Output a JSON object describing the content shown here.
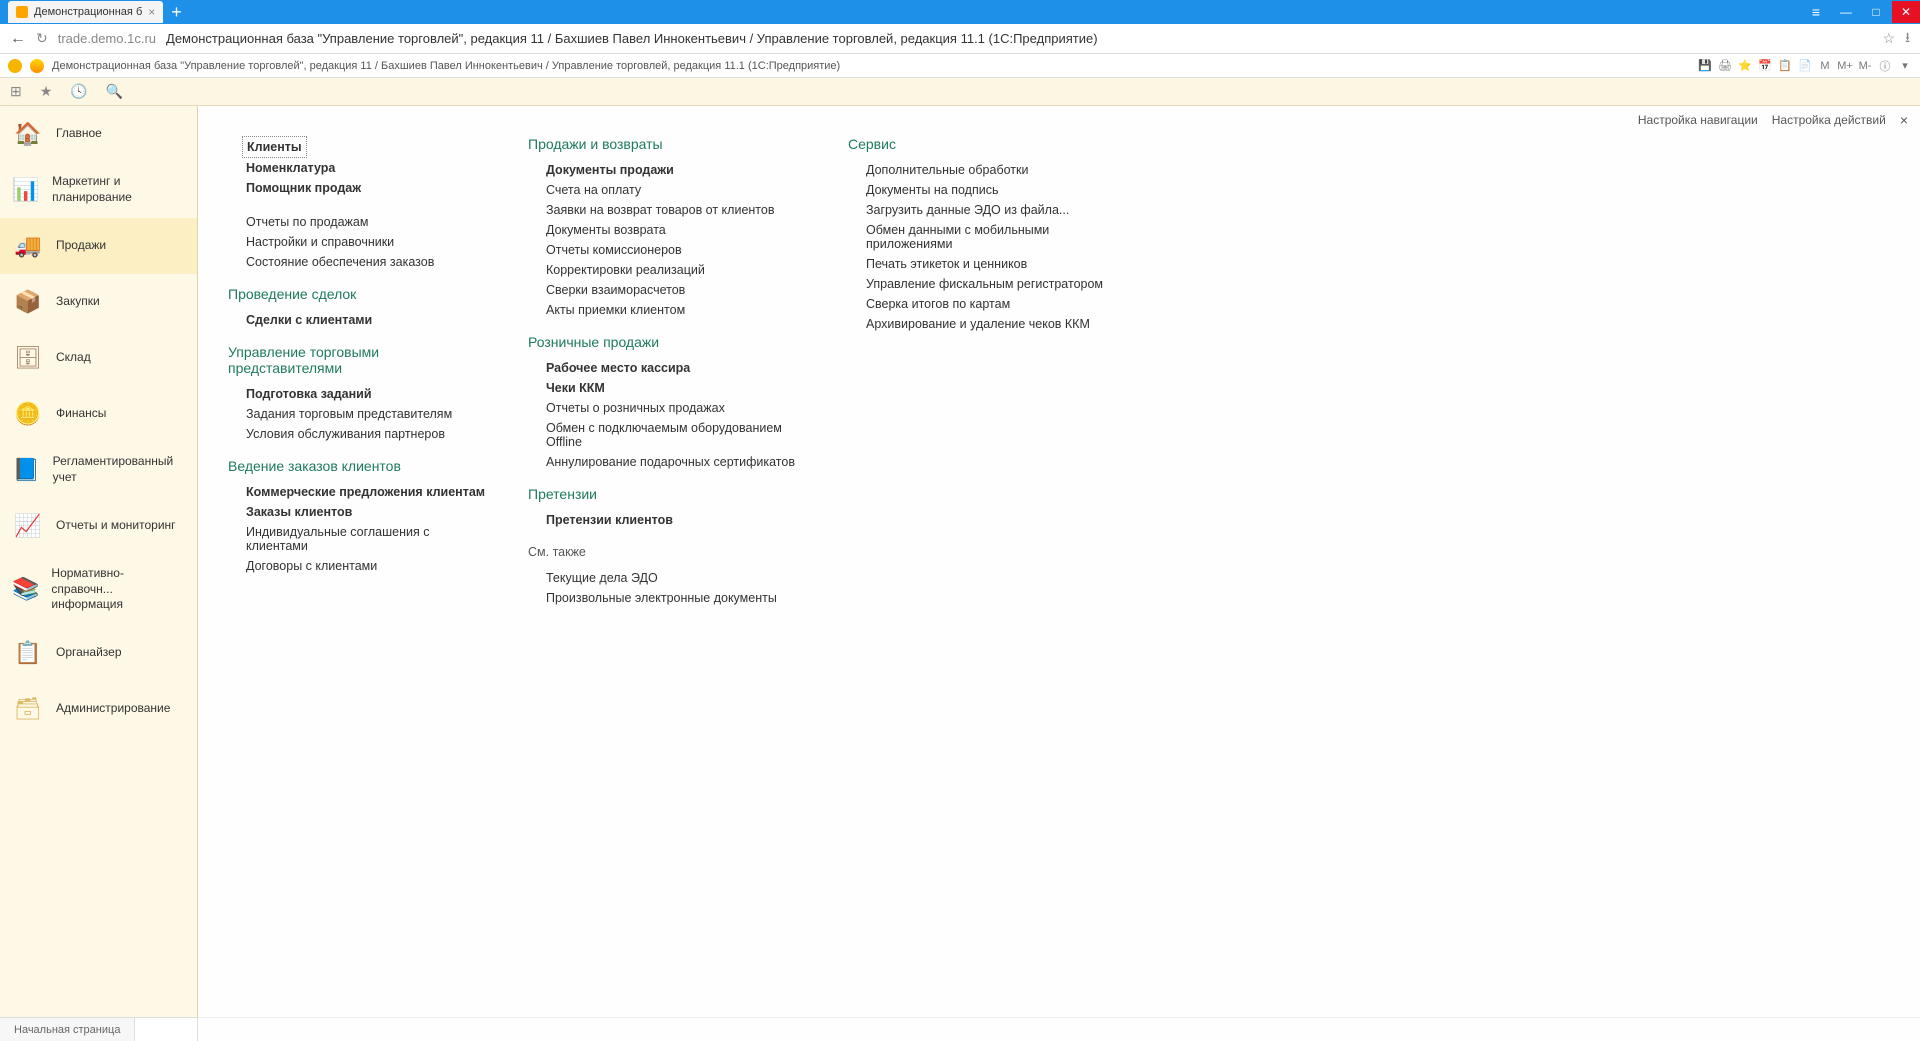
{
  "browser": {
    "tab_title": "Демонстрационная б",
    "url": "trade.demo.1c.ru",
    "page_title": "Демонстрационная база \"Управление торговлей\", редакция 11 / Бахшиев Павел Иннокентьевич / Управление торговлей, редакция 11.1 (1С:Предприятие)"
  },
  "app_header": {
    "title": "Демонстрационная база \"Управление торговлей\", редакция 11 / Бахшиев Павел Иннокентьевич / Управление торговлей, редакция 11.1  (1С:Предприятие)",
    "m": "M",
    "mplus": "M+",
    "mminus": "M-"
  },
  "sidebar": {
    "items": [
      {
        "label": "Главное"
      },
      {
        "label": "Маркетинг и планирование"
      },
      {
        "label": "Продажи"
      },
      {
        "label": "Закупки"
      },
      {
        "label": "Склад"
      },
      {
        "label": "Финансы"
      },
      {
        "label": "Регламентированный учет"
      },
      {
        "label": "Отчеты и мониторинг"
      },
      {
        "label": "Нормативно-справочн... информация"
      },
      {
        "label": "Органайзер"
      },
      {
        "label": "Администрирование"
      }
    ]
  },
  "content_header": {
    "nav_settings": "Настройка навигации",
    "action_settings": "Настройка действий"
  },
  "col1": {
    "group0": [
      {
        "t": "Клиенты",
        "bold": true,
        "selected": true
      },
      {
        "t": "Номенклатура",
        "bold": true
      },
      {
        "t": "Помощник продаж",
        "bold": true
      }
    ],
    "group0b": [
      {
        "t": "Отчеты по продажам"
      },
      {
        "t": "Настройки и справочники"
      },
      {
        "t": "Состояние обеспечения заказов"
      }
    ],
    "title1": "Проведение сделок",
    "group1": [
      {
        "t": "Сделки с клиентами",
        "bold": true
      }
    ],
    "title2": "Управление торговыми представителями",
    "group2": [
      {
        "t": "Подготовка заданий",
        "bold": true
      },
      {
        "t": "Задания торговым представителям"
      },
      {
        "t": "Условия обслуживания партнеров"
      }
    ],
    "title3": "Ведение заказов клиентов",
    "group3": [
      {
        "t": "Коммерческие предложения клиентам",
        "bold": true
      },
      {
        "t": "Заказы клиентов",
        "bold": true
      },
      {
        "t": "Индивидуальные соглашения с клиентами"
      },
      {
        "t": "Договоры с клиентами"
      }
    ]
  },
  "col2": {
    "title1": "Продажи и возвраты",
    "group1": [
      {
        "t": "Документы продажи",
        "bold": true
      },
      {
        "t": "Счета на оплату"
      },
      {
        "t": "Заявки на возврат товаров от клиентов"
      },
      {
        "t": "Документы возврата"
      },
      {
        "t": "Отчеты комиссионеров"
      },
      {
        "t": "Корректировки реализаций"
      },
      {
        "t": "Сверки взаиморасчетов"
      },
      {
        "t": "Акты приемки клиентом"
      }
    ],
    "title2": "Розничные продажи",
    "group2": [
      {
        "t": "Рабочее место кассира",
        "bold": true
      },
      {
        "t": "Чеки ККМ",
        "bold": true
      },
      {
        "t": "Отчеты о розничных продажах"
      },
      {
        "t": "Обмен с подключаемым оборудованием Offline"
      },
      {
        "t": "Аннулирование подарочных сертификатов"
      }
    ],
    "title3": "Претензии",
    "group3": [
      {
        "t": "Претензии клиентов",
        "bold": true
      }
    ],
    "see_also": "См. также",
    "group4": [
      {
        "t": "Текущие дела ЭДО"
      },
      {
        "t": "Произвольные электронные документы"
      }
    ]
  },
  "col3": {
    "title1": "Сервис",
    "group1": [
      {
        "t": "Дополнительные обработки"
      },
      {
        "t": "Документы на подпись"
      },
      {
        "t": "Загрузить данные ЭДО из файла..."
      },
      {
        "t": "Обмен данными с мобильными приложениями"
      },
      {
        "t": "Печать этикеток и ценников"
      },
      {
        "t": "Управление фискальным регистратором"
      },
      {
        "t": "Сверка итогов по картам"
      },
      {
        "t": "Архивирование и удаление чеков ККМ"
      }
    ]
  },
  "footer": {
    "home": "Начальная страница"
  }
}
